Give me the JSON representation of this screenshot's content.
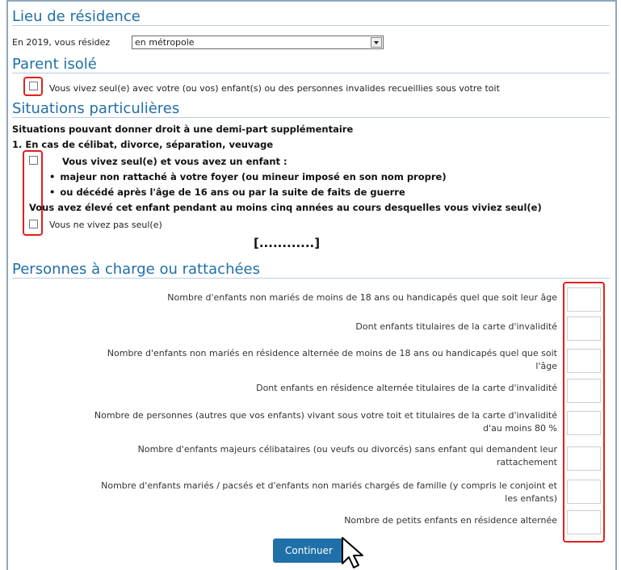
{
  "sections": {
    "residence": {
      "title": "Lieu de résidence",
      "label": "En 2019, vous résidez",
      "select_value": "en métropole"
    },
    "parent_isole": {
      "title": "Parent isolé",
      "checkbox_label": "Vous vivez seul(e) avec votre (ou vos) enfant(s) ou des personnes invalides recueillies sous votre toit"
    },
    "situations": {
      "title": "Situations particulières",
      "intro": "Situations pouvant donner droit à une demi-part supplémentaire",
      "subtitle": "1. En cas de célibat, divorce, séparation, veuvage",
      "check1_label": "Vous vivez seul(e) et vous avez un enfant :",
      "bullets": [
        "majeur non rattaché à votre foyer (ou mineur imposé en son nom propre)",
        "ou décédé après l'âge de 16 ans ou par la suite de faits de guerre"
      ],
      "raised_text": "Vous avez élevé cet enfant pendant au moins cinq années au cours desquelles vous viviez seul(e)",
      "check2_label": "Vous ne vivez pas seul(e)",
      "ellipsis": "[............]"
    },
    "personnes": {
      "title": "Personnes à charge ou rattachées",
      "rows": [
        [
          "Nombre d'enfants non mariés de moins de 18 ans ou handicapés quel que soit leur âge"
        ],
        [
          "Dont enfants titulaires de la carte d'invalidité"
        ],
        [
          "Nombre d'enfants non mariés en résidence alternée de moins de 18 ans ou handicapés quel que soit",
          "l'âge"
        ],
        [
          "Dont enfants en résidence alternée titulaires de la carte d'invalidité"
        ],
        [
          "Nombre de personnes (autres que vos enfants) vivant sous votre toit et titulaires de la carte d'invalidité",
          "d'au moins 80 %"
        ],
        [
          "Nombre d'enfants majeurs célibataires (ou veufs ou divorcés) sans enfant qui demandent leur",
          "rattachement"
        ],
        [
          "Nombre d'enfants mariés / pacsés et d'enfants non mariés chargés de famille (y compris le conjoint et",
          "les enfants)"
        ],
        [
          "Nombre de petits enfants en résidence alternée"
        ]
      ]
    }
  },
  "buttons": {
    "continue_label": "Continuer"
  },
  "colors": {
    "heading": "#1f6fa8",
    "highlight": "#e02020",
    "button": "#1f6fa8"
  }
}
